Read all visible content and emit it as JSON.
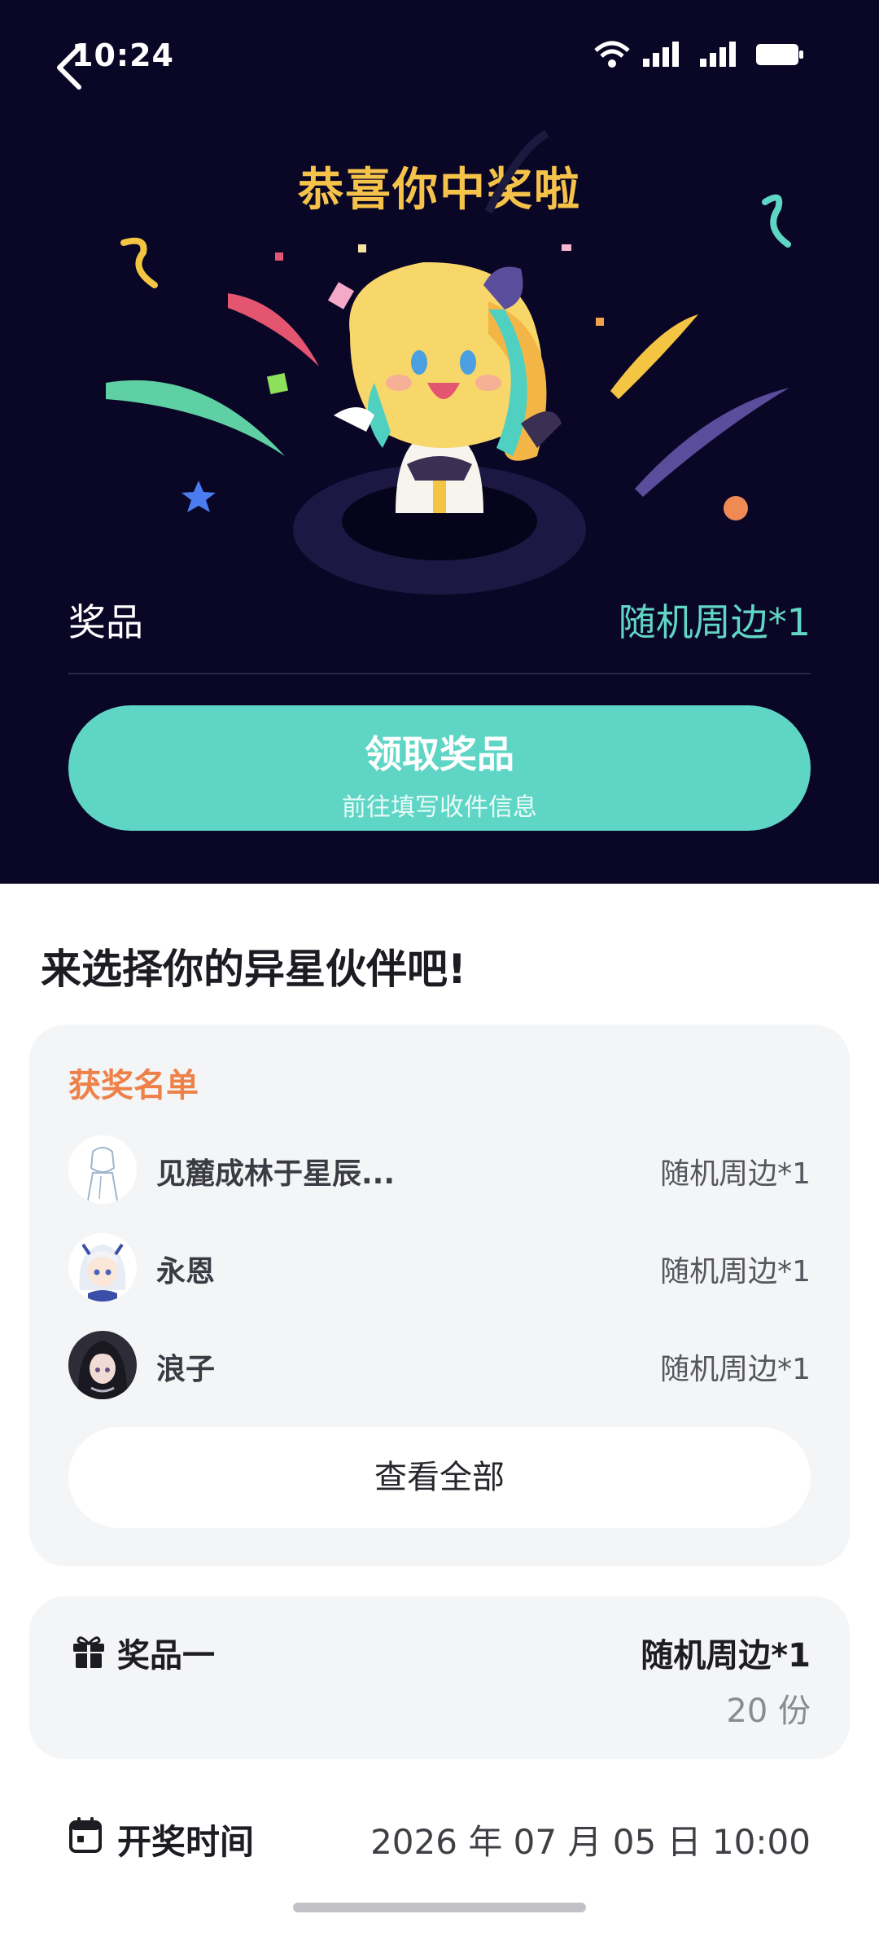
{
  "status_bar": {
    "time": "10:24"
  },
  "hero": {
    "title": "恭喜你中奖啦",
    "prize_label": "奖品",
    "prize_value": "随机周边*1",
    "claim_button": {
      "title": "领取奖品",
      "subtitle": "前往填写收件信息"
    }
  },
  "section_title": "来选择你的异星伙伴吧!",
  "winners": {
    "heading": "获奖名单",
    "items": [
      {
        "name": "见麓成林于星辰...",
        "prize": "随机周边*1"
      },
      {
        "name": "永恩",
        "prize": "随机周边*1"
      },
      {
        "name": "浪子",
        "prize": "随机周边*1"
      }
    ],
    "view_all_label": "查看全部"
  },
  "prize_card": {
    "label": "奖品一",
    "value": "随机周边*1",
    "count": "20 份"
  },
  "draw_time": {
    "label": "开奖时间",
    "value": "2026 年 07 月 05 日 10:00"
  },
  "colors": {
    "hero_bg": "#0a0626",
    "accent_teal": "#5fd6c5",
    "title_gold": "#f5c24a",
    "winners_orange": "#ee8148"
  }
}
